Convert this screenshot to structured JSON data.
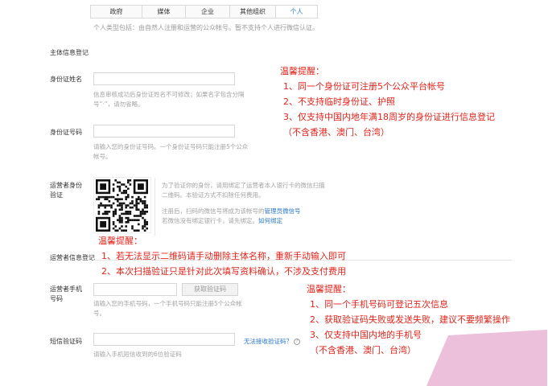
{
  "tabs": [
    "政府",
    "媒体",
    "企业",
    "其他组织",
    "个人"
  ],
  "active_tab": 4,
  "top_hint": "个人类型包括：由自然人注册和运营的公众帐号。暂不支持个人进行微信认证。",
  "section_title": "主体信息登记",
  "fields": {
    "id_name": {
      "label": "身份证姓名",
      "help_line1": "信息审核成功后身份证姓名不可修改；如果名字包含分隔",
      "help_line2": "号“·”，请勿省略。"
    },
    "id_number": {
      "label": "身份证号码",
      "help_line1": "请输入您的身份证号码。一个身份证号码只能注册5个公众",
      "help_line2": "帐号。"
    },
    "operator_verify": {
      "label_line1": "运营者身份",
      "label_line2": "验证",
      "desc_line1": "为了验证你的身份，请用绑定了运营者本人银行卡的微信扫描",
      "desc_line2": "二维码。本验证方式不扣除任何费用。",
      "desc_line3": "注册后，扫码的微信号将成为该帐号的",
      "desc_link1": "管理员微信号",
      "desc_line4": "若微信没有绑定银行卡，请先绑定。",
      "desc_link2": "如何绑定"
    },
    "operator_info": {
      "label": "运营者信息登记"
    },
    "phone": {
      "label_line1": "运营者手机",
      "label_line2": "号码",
      "button": "获取验证码",
      "help_line1": "请输入您的手机号码，一个手机号码只能注册5个公众帐",
      "help_line2": "号。"
    },
    "sms": {
      "label": "短信验证码",
      "link": "无法接收验证码？",
      "help": "请输入手机短信收到的6位验证码"
    }
  },
  "notes": {
    "note1": {
      "title": "温馨提醒：",
      "lines": [
        "1、同一个身份证可注册5个公众平台帐号",
        "2、不支持临时身份证、护照",
        "3、仅支持中国内地年满18周岁的身份证进行信息登记",
        "（不含香港、澳门、台湾）"
      ]
    },
    "note2": {
      "title": "温馨提醒：",
      "lines": [
        "1、若无法显示二维码请手动删除主体名称，重新手动输入即可",
        "2、本次扫描验证只是针对此次填写资料确认，不涉及支付费用"
      ]
    },
    "note3": {
      "title": "温馨提醒：",
      "lines": [
        "1、同一个手机号码可登记五次信息",
        "2、获取验证码失败或发送失败，建议不要频繁操作",
        "3、仅支持中国内地的手机号",
        "（不含香港、澳门、台湾）"
      ]
    }
  }
}
